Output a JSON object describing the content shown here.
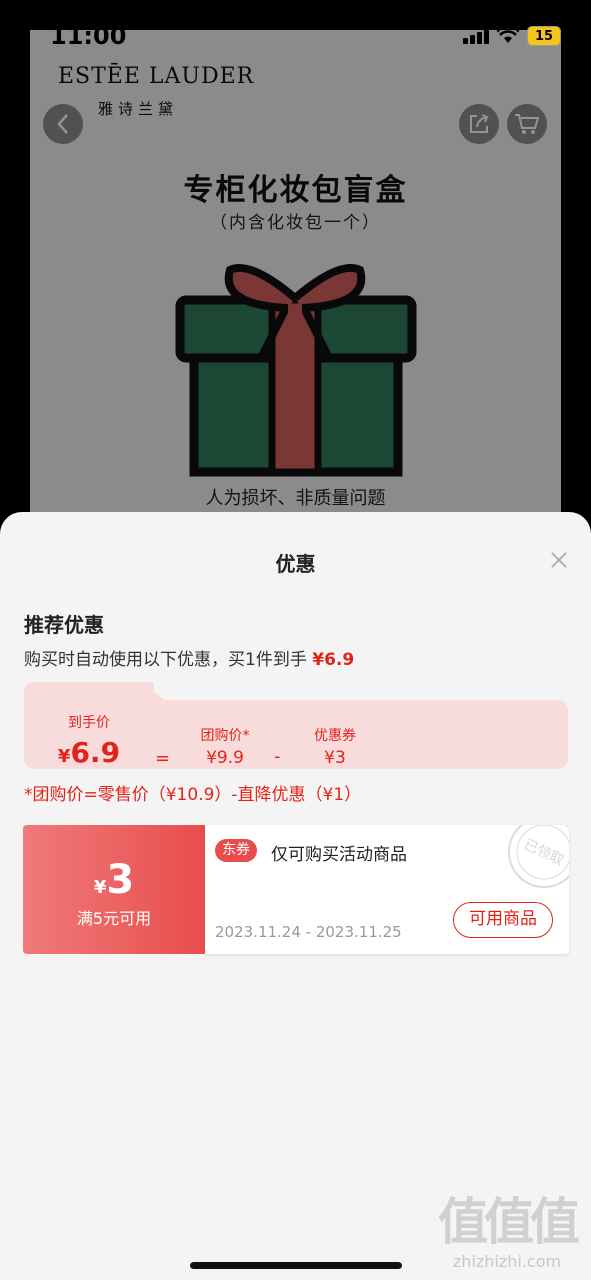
{
  "status_bar": {
    "time": "11:00",
    "battery": "15"
  },
  "product_page": {
    "brand": "ESTĒE LAUDER",
    "brand_cn": "雅诗兰黛",
    "promo_title": "专柜化妆包盲盒",
    "promo_subtitle": "（内含化妆包一个）",
    "promo_note": "人为损坏、非质量问题"
  },
  "sheet": {
    "title": "优惠",
    "recommend_heading": "推荐优惠",
    "recommend_desc_prefix": "购买时自动使用以下优惠，买",
    "recommend_desc_count": "1",
    "recommend_desc_mid": "件到手",
    "recommend_desc_price": "¥6.9",
    "breakdown": {
      "final_label": "到手价",
      "final_yen": "¥",
      "final_value": "6.9",
      "eq": "=",
      "group_label": "团购价*",
      "group_value": "¥9.9",
      "minus": "-",
      "coupon_label": "优惠券",
      "coupon_value": "¥3"
    },
    "formula": "*团购价=零售价（¥10.9）-直降优惠（¥1）",
    "coupon": {
      "yen": "¥",
      "amount": "3",
      "condition": "满5元可用",
      "tag": "东券",
      "description": "仅可购买活动商品",
      "stamp_text": "已领取",
      "date_range": "2023.11.24 - 2023.11.25",
      "button": "可用商品"
    }
  },
  "watermark": {
    "big": "值值值",
    "small": "zhizhizhi.com"
  },
  "colors": {
    "accent": "#e2231a",
    "coupon_gradient_start": "#f07a7a",
    "coupon_gradient_end": "#e84d4d",
    "breakdown_bg": "#f8dcdc"
  }
}
